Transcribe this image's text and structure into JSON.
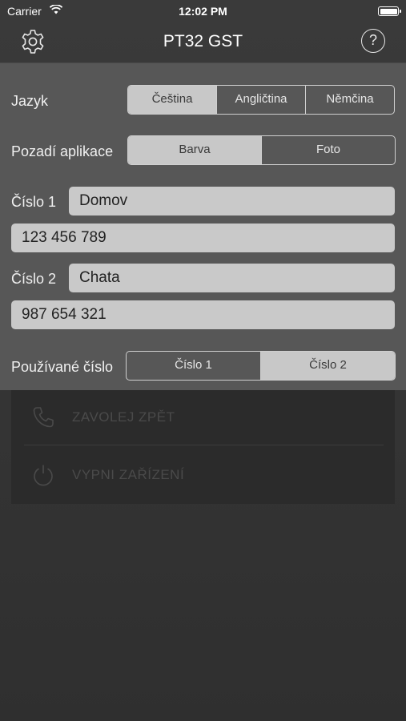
{
  "status_bar": {
    "carrier": "Carrier",
    "time": "12:02 PM"
  },
  "nav": {
    "title": "PT32 GST",
    "help_label": "?"
  },
  "settings": {
    "language": {
      "label": "Jazyk",
      "options": [
        "Čeština",
        "Angličtina",
        "Němčina"
      ],
      "selected": 0
    },
    "background": {
      "label": "Pozadí aplikace",
      "options": [
        "Barva",
        "Foto"
      ],
      "selected": 0
    },
    "number1": {
      "label": "Číslo 1",
      "name": "Domov",
      "phone": "123 456 789"
    },
    "number2": {
      "label": "Číslo 2",
      "name": "Chata",
      "phone": "987 654 321"
    },
    "active_number": {
      "label": "Používané číslo",
      "options": [
        "Číslo 1",
        "Číslo 2"
      ],
      "selected": 1
    }
  },
  "actions": [
    {
      "label": "ZAVOLEJ ZPĚT",
      "icon": "phone-icon"
    },
    {
      "label": "VYPNI ZAŘÍZENÍ",
      "icon": "power-icon"
    }
  ],
  "colors": {
    "panel": "#575757",
    "selected_segment": "#c8c8c8",
    "field": "#c9c9c9",
    "background": "#353535"
  }
}
